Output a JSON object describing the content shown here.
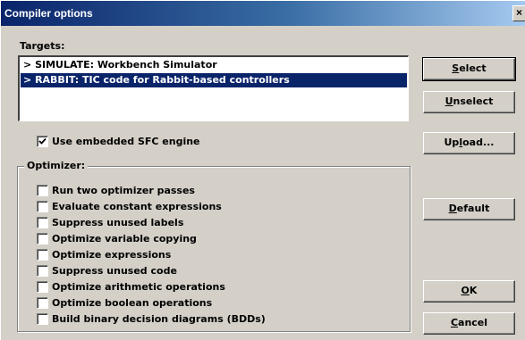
{
  "window": {
    "title": "Compiler options",
    "close_glyph": "×"
  },
  "targets": {
    "label": "Targets:",
    "items": [
      {
        "arrow": ">",
        "text": "SIMULATE: Workbench Simulator",
        "selected": false
      },
      {
        "arrow": ">",
        "text": "RABBIT: TIC code for Rabbit-based controllers",
        "selected": true
      }
    ]
  },
  "sfc": {
    "label": "Use embedded SFC engine",
    "checked": true
  },
  "optimizer": {
    "label": "Optimizer:",
    "options": [
      {
        "label": "Run two optimizer passes",
        "checked": false
      },
      {
        "label": "Evaluate constant expressions",
        "checked": false
      },
      {
        "label": "Suppress unused labels",
        "checked": false
      },
      {
        "label": "Optimize variable copying",
        "checked": false
      },
      {
        "label": "Optimize expressions",
        "checked": false
      },
      {
        "label": "Suppress unused code",
        "checked": false
      },
      {
        "label": "Optimize arithmetic operations",
        "checked": false
      },
      {
        "label": "Optimize boolean operations",
        "checked": false
      },
      {
        "label": "Build binary decision diagrams (BDDs)",
        "checked": false
      }
    ]
  },
  "buttons": {
    "select": {
      "mnemonic": "S",
      "rest": "elect"
    },
    "unselect": {
      "mnemonic": "U",
      "rest": "nselect"
    },
    "upload": {
      "pre": "Up",
      "mnemonic": "l",
      "rest": "oad..."
    },
    "default": {
      "mnemonic": "D",
      "rest": "efault"
    },
    "ok": {
      "mnemonic": "O",
      "rest": "K"
    },
    "cancel": {
      "mnemonic": "C",
      "rest": "ancel"
    }
  },
  "colors": {
    "titlebar_start": "#0a246a",
    "titlebar_end": "#a6caf0",
    "selection": "#0a246a",
    "face": "#d4d0c8"
  }
}
